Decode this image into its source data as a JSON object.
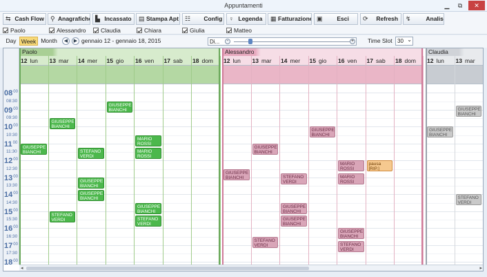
{
  "window": {
    "title": "Appuntamenti"
  },
  "toolbar": [
    {
      "label": "Cash Flow",
      "icon": "arrows-icon"
    },
    {
      "label": "Anagrafiche",
      "icon": "person-icon"
    },
    {
      "label": "Incassato",
      "icon": "chart-icon"
    },
    {
      "label": "Stampa Apt",
      "icon": "printer-icon"
    },
    {
      "label": "Config",
      "icon": "gear-icon"
    },
    {
      "label": "Legenda",
      "icon": "bulb-icon"
    },
    {
      "label": "Fatturazione",
      "icon": "invoice-icon"
    },
    {
      "label": "Esci",
      "icon": "exit-icon"
    },
    {
      "label": "Refresh",
      "icon": "refresh-icon"
    },
    {
      "label": "Analisi",
      "icon": "analysis-icon"
    }
  ],
  "filters": [
    "Paolo",
    "Alessandro",
    "Claudia",
    "Chiara",
    "Giulia",
    "Matteo"
  ],
  "nav": {
    "views": [
      "Day",
      "Week",
      "Month"
    ],
    "active_view": "Week",
    "date_range": "gennaio 12 - gennaio 18, 2015",
    "zoom_label": "Di...",
    "zoom_level": 0.12,
    "timeslot_label": "Time Slot",
    "timeslot_value": "30"
  },
  "days": [
    [
      "12",
      "lun"
    ],
    [
      "13",
      "mar"
    ],
    [
      "14",
      "mer"
    ],
    [
      "15",
      "gio"
    ],
    [
      "16",
      "ven"
    ],
    [
      "17",
      "sab"
    ],
    [
      "18",
      "dom"
    ]
  ],
  "hours": [
    {
      "h": "08",
      "m": "00",
      "half": "08:30"
    },
    {
      "h": "09",
      "m": "00",
      "half": "09:30"
    },
    {
      "h": "10",
      "m": "00",
      "half": "10:30"
    },
    {
      "h": "11",
      "m": "00",
      "half": "11:30"
    },
    {
      "h": "12",
      "m": "00",
      "half": "12:30"
    },
    {
      "h": "13",
      "m": "00",
      "half": "13:30"
    },
    {
      "h": "14",
      "m": "00",
      "half": "14:30"
    },
    {
      "h": "15",
      "m": "00",
      "half": "15:30"
    },
    {
      "h": "16",
      "m": "00",
      "half": "16:30"
    },
    {
      "h": "17",
      "m": "00",
      "half": "17:30"
    },
    {
      "h": "18",
      "m": "00",
      "half": ""
    }
  ],
  "resources": [
    {
      "name": "Paolo",
      "days": 7,
      "events": [
        {
          "d": 3,
          "t": 8.5,
          "text": "GIUSEPPE\nBIANCHI"
        },
        {
          "d": 1,
          "t": 9.5,
          "text": "GIUSEPPE\nBIANCHI"
        },
        {
          "d": 4,
          "t": 10.5,
          "text": "MARIO\nROSSI"
        },
        {
          "d": 0,
          "t": 11,
          "text": "GIUSEPPE\nBIANCHI"
        },
        {
          "d": 2,
          "t": 11.25,
          "text": "STEFANO\nVERDI"
        },
        {
          "d": 4,
          "t": 11.25,
          "text": "MARIO\nROSSI"
        },
        {
          "d": 2,
          "t": 13,
          "text": "GIUSEPPE\nBIANCHI"
        },
        {
          "d": 2,
          "t": 13.75,
          "text": "GIUSEPPE\nBIANCHI"
        },
        {
          "d": 4,
          "t": 14.5,
          "text": "GIUSEPPE\nBIANCHI"
        },
        {
          "d": 1,
          "t": 15,
          "text": "STEFANO\nVERDI"
        },
        {
          "d": 4,
          "t": 15.25,
          "text": "STEFANO\nVERDI"
        }
      ]
    },
    {
      "name": "Alessandro",
      "days": 7,
      "events": [
        {
          "d": 3,
          "t": 10,
          "text": "GIUSEPPE\nBIANCHI"
        },
        {
          "d": 1,
          "t": 11,
          "text": "GIUSEPPE\nBIANCHI"
        },
        {
          "d": 4,
          "t": 12,
          "text": "MARIO\nROSSI"
        },
        {
          "d": 5,
          "t": 12,
          "text": "pausa [RIP.]",
          "kind": "o"
        },
        {
          "d": 0,
          "t": 12.5,
          "text": "GIUSEPPE\nBIANCHI"
        },
        {
          "d": 2,
          "t": 12.75,
          "text": "STEFANO\nVERDI"
        },
        {
          "d": 4,
          "t": 12.75,
          "text": "MARIO\nROSSI"
        },
        {
          "d": 2,
          "t": 14.5,
          "text": "GIUSEPPE\nBIANCHI"
        },
        {
          "d": 2,
          "t": 15.25,
          "text": "GIUSEPPE\nBIANCHI"
        },
        {
          "d": 4,
          "t": 16,
          "text": "GIUSEPPE\nBIANCHI"
        },
        {
          "d": 1,
          "t": 16.5,
          "text": "STEFANO\nVERDI"
        },
        {
          "d": 4,
          "t": 16.75,
          "text": "STEFANO\nVERDI"
        }
      ]
    },
    {
      "name": "Claudia",
      "days": 2,
      "events": [
        {
          "d": 1,
          "t": 8.75,
          "text": "GIUSEPPE\nBIANCHI"
        },
        {
          "d": 0,
          "t": 10,
          "text": "GIUSEPPE\nBIANCHI"
        },
        {
          "d": 1,
          "t": 14,
          "text": "STEFANO\nVERDI"
        }
      ]
    }
  ],
  "colors": {
    "paolo": "#4cb84c",
    "alessandro": "#d9a5b8",
    "claudia": "#c9c9c9",
    "accent": "#f7d978"
  }
}
